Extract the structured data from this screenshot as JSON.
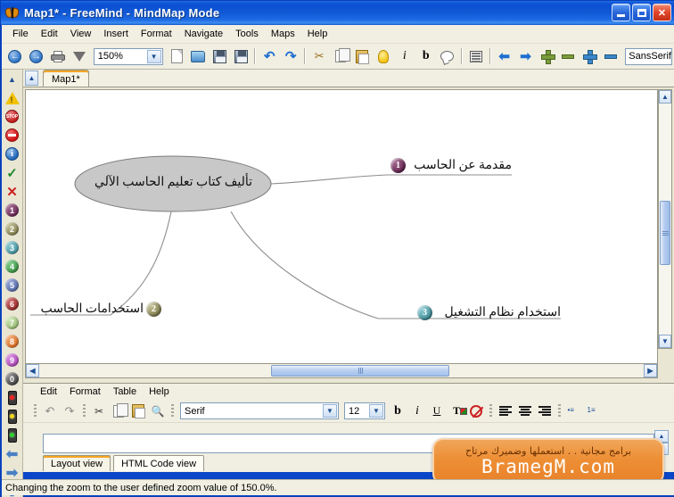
{
  "window": {
    "title": "Map1* - FreeMind - MindMap Mode",
    "app_icon": "butterfly-icon",
    "minimize_label": "",
    "maximize_label": "",
    "close_label": "✕"
  },
  "menubar": {
    "items": [
      "File",
      "Edit",
      "View",
      "Insert",
      "Format",
      "Navigate",
      "Tools",
      "Maps",
      "Help"
    ]
  },
  "toolbar": {
    "back_icon": "back-arrow-icon",
    "forward_icon": "forward-arrow-icon",
    "print_icon": "printer-icon",
    "filter_icon": "filter-funnel-icon",
    "zoom_value": "150%",
    "new_icon": "new-document-icon",
    "open_icon": "open-folder-icon",
    "save_icon": "save-disk-icon",
    "saveas_icon": "save-as-icon",
    "undo_icon": "undo-icon",
    "redo_icon": "redo-icon",
    "cut_icon": "scissors-icon",
    "copy_icon": "copy-icon",
    "paste_icon": "paste-icon",
    "bulb_icon": "lightbulb-icon",
    "italic_label": "i",
    "bold_label": "b",
    "cloud_icon": "cloud-icon",
    "table_icon": "table-icon",
    "left_icon": "move-left-icon",
    "right_icon": "move-right-icon",
    "zoom_in_green_icon": "node-increase-icon",
    "zoom_out_green_icon": "node-decrease-icon",
    "zoom_in_blue_icon": "font-increase-icon",
    "zoom_out_blue_icon": "font-decrease-icon",
    "font_value": "SansSerif"
  },
  "icon_sidebar": {
    "items": [
      {
        "name": "warning-icon",
        "label": ""
      },
      {
        "name": "stop-sign-icon",
        "label": "STOP"
      },
      {
        "name": "no-entry-icon",
        "label": ""
      },
      {
        "name": "info-icon",
        "label": "i"
      },
      {
        "name": "check-icon",
        "label": "✓"
      },
      {
        "name": "cross-icon",
        "label": "✕"
      },
      {
        "name": "number-1-icon",
        "label": "1",
        "color": "#6d2a58"
      },
      {
        "name": "number-2-icon",
        "label": "2",
        "color": "#8b8757"
      },
      {
        "name": "number-3-icon",
        "label": "3",
        "color": "#4a9aa5"
      },
      {
        "name": "number-4-icon",
        "label": "4",
        "color": "#3f9a4a"
      },
      {
        "name": "number-5-icon",
        "label": "5",
        "color": "#5a6fae"
      },
      {
        "name": "number-6-icon",
        "label": "6",
        "color": "#9b2f2f"
      },
      {
        "name": "number-7-icon",
        "label": "7",
        "color": "#9fc47a"
      },
      {
        "name": "number-8-icon",
        "label": "8",
        "color": "#e0742a"
      },
      {
        "name": "number-9-icon",
        "label": "9",
        "color": "#b44fc0"
      },
      {
        "name": "number-0-icon",
        "label": "0",
        "color": "#4a4a4a"
      },
      {
        "name": "traffic-light-red-icon",
        "label": "",
        "color": "#d81f1f"
      },
      {
        "name": "traffic-light-yellow-icon",
        "label": "",
        "color": "#e8d21a"
      },
      {
        "name": "traffic-light-green-icon",
        "label": "",
        "color": "#2fbf2f"
      },
      {
        "name": "arrow-left-icon",
        "label": "←"
      },
      {
        "name": "arrow-right-icon",
        "label": "→"
      },
      {
        "name": "arrow-up-icon",
        "label": "↑"
      }
    ],
    "scroll_up_icon": "scroll-up-icon",
    "scroll_down_icon": "scroll-down-icon"
  },
  "tabstrip": {
    "scroll_icon": "tab-scroll-up-icon",
    "tabs": [
      {
        "label": "Map1*"
      }
    ]
  },
  "mindmap": {
    "root": {
      "text": "تأليف كتاب تعليم الحاسب الآلي"
    },
    "branches": [
      {
        "text": "مقدمة عن الحاسب",
        "badge": "1",
        "badge_color": "#6d2a58"
      },
      {
        "text": "استخدامات الحاسب",
        "badge": "2",
        "badge_color": "#8b8757"
      },
      {
        "text": "استخدام نظام التشغيل",
        "badge": "3",
        "badge_color": "#4a9aa5"
      }
    ]
  },
  "scrollbars": {
    "v_up_icon": "scroll-up-arrow-icon",
    "v_down_icon": "scroll-down-arrow-icon",
    "h_left_icon": "scroll-left-arrow-icon",
    "h_right_icon": "scroll-right-arrow-icon"
  },
  "editor": {
    "menu_items": [
      "Edit",
      "Format",
      "Table",
      "Help"
    ],
    "undo_icon": "undo-icon",
    "redo_icon": "redo-icon",
    "cut_icon": "cut-scissors-icon",
    "copy_icon": "copy-pages-icon",
    "paste_icon": "paste-clipboard-icon",
    "find_icon": "find-binoculars-icon",
    "font_value": "Serif",
    "size_value": "12",
    "bold_label": "b",
    "italic_label": "i",
    "underline_label": "U",
    "text_color_icon": "text-color-icon",
    "clear_format_icon": "clear-formatting-icon",
    "align_left_icon": "align-left-icon",
    "align_center_icon": "align-center-icon",
    "align_right_icon": "align-right-icon",
    "bullet_list_icon": "bullet-list-icon",
    "numbered_list_icon": "numbered-list-icon",
    "content_value": "",
    "view_tabs": [
      {
        "label": "Layout view",
        "active": true
      },
      {
        "label": "HTML Code view",
        "active": false
      }
    ]
  },
  "watermark": {
    "arabic": "برامج مجانية . . استعملها وضميرك مرتاح",
    "site": "BramegM.com"
  },
  "statusbar": {
    "message": "Changing the zoom to the user defined zoom value of 150.0%."
  },
  "colors": {
    "titlebar": "#0a4fd0",
    "chrome": "#f1efe2",
    "canvas": "#ffffff",
    "root_fill": "#c8c8c8",
    "accent": "#f5a623",
    "watermark": "#ee8f35"
  }
}
